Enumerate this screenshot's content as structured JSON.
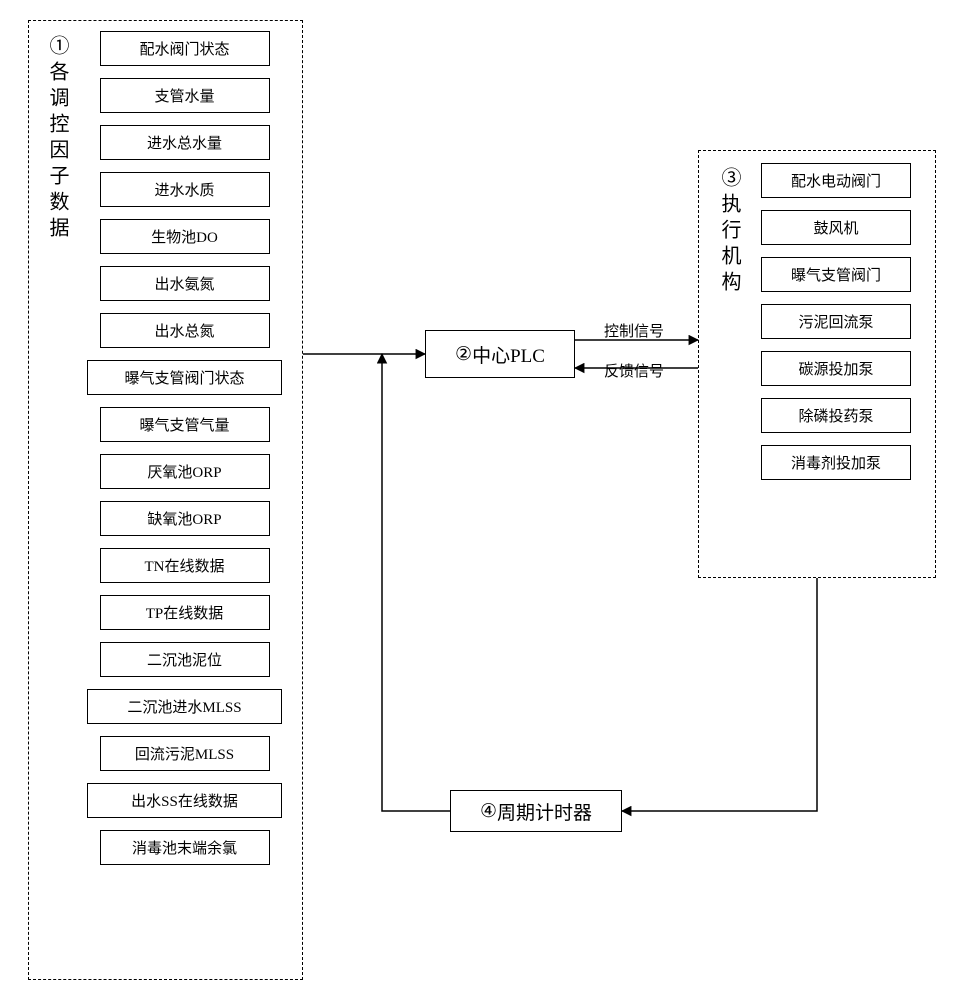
{
  "panel1": {
    "circled": "①",
    "title": "各调控因子数据",
    "items": [
      "配水阀门状态",
      "支管水量",
      "进水总水量",
      "进水水质",
      "生物池DO",
      "出水氨氮",
      "出水总氮",
      "曝气支管阀门状态",
      "曝气支管气量",
      "厌氧池ORP",
      "缺氧池ORP",
      "TN在线数据",
      "TP在线数据",
      "二沉池泥位",
      "二沉池进水MLSS",
      "回流污泥MLSS",
      "出水SS在线数据",
      "消毒池末端余氯"
    ]
  },
  "plc": {
    "circled": "②",
    "label": "中心PLC"
  },
  "panel3": {
    "circled": "③",
    "title": "执行机构",
    "items": [
      "配水电动阀门",
      "鼓风机",
      "曝气支管阀门",
      "污泥回流泵",
      "碳源投加泵",
      "除磷投药泵",
      "消毒剂投加泵"
    ]
  },
  "timer": {
    "circled": "④",
    "label": "周期计时器"
  },
  "edges": {
    "ctrl": "控制信号",
    "fb": "反馈信号"
  }
}
